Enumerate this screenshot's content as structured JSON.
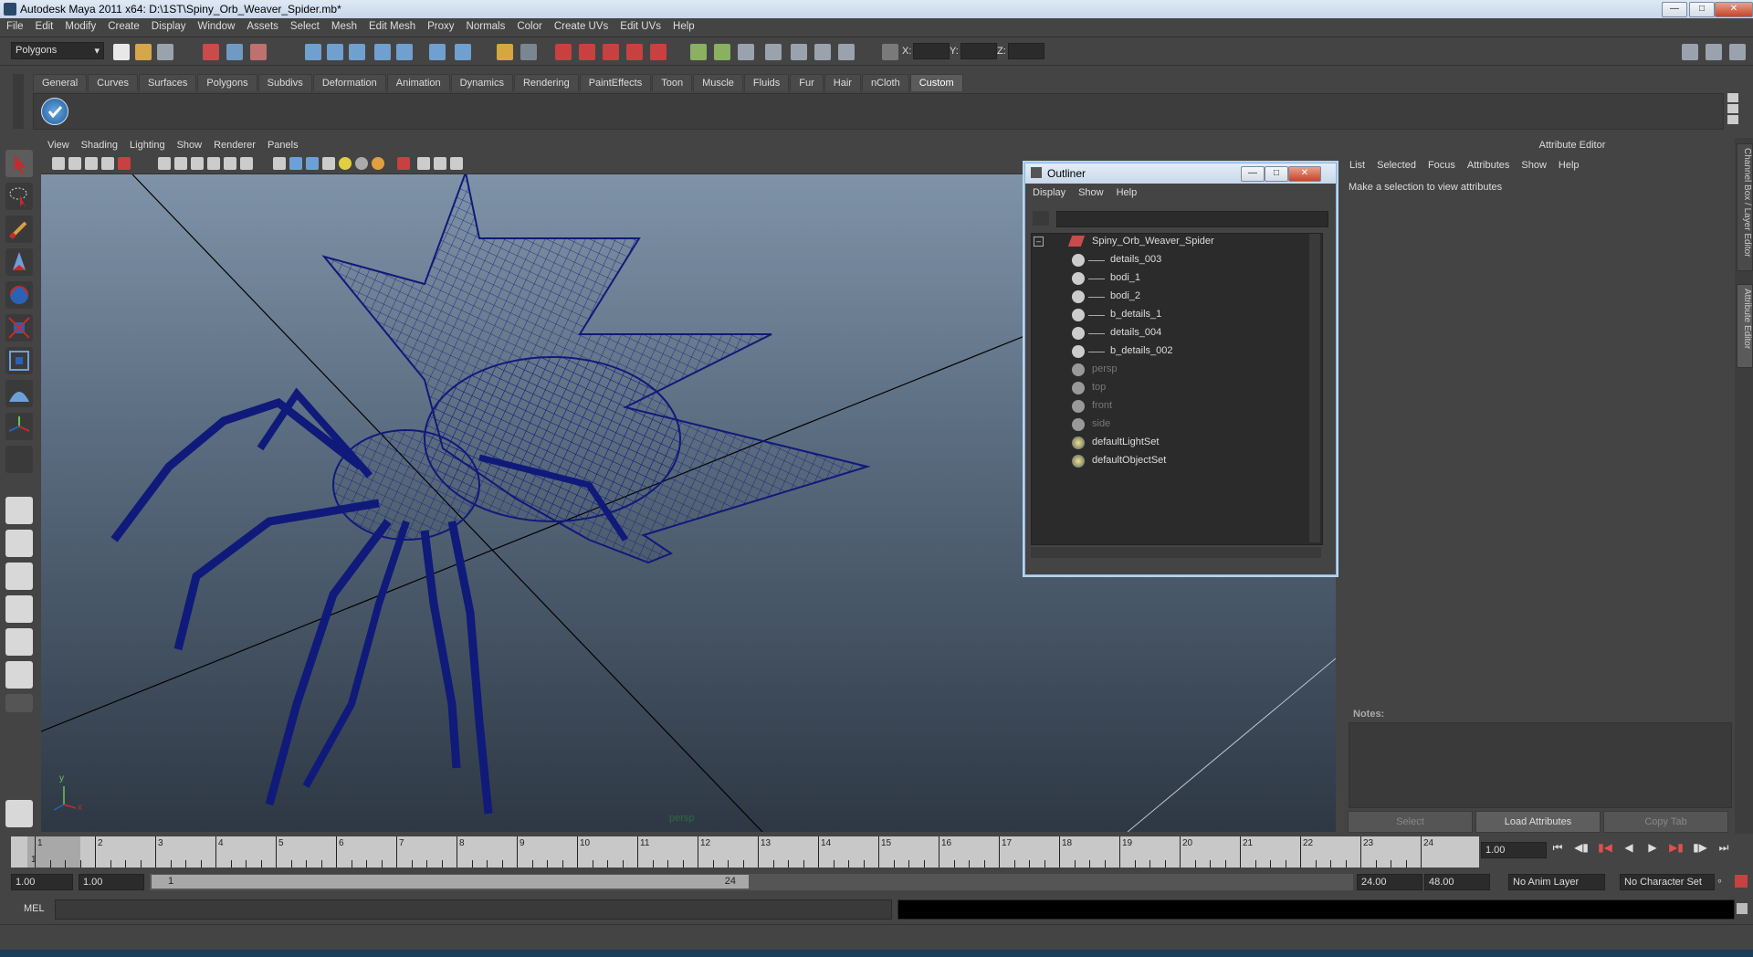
{
  "window": {
    "title": "Autodesk Maya 2011 x64: D:\\1ST\\Spiny_Orb_Weaver_Spider.mb*"
  },
  "menubar": [
    "File",
    "Edit",
    "Modify",
    "Create",
    "Display",
    "Window",
    "Assets",
    "Select",
    "Mesh",
    "Edit Mesh",
    "Proxy",
    "Normals",
    "Color",
    "Create UVs",
    "Edit UVs",
    "Help"
  ],
  "statusline": {
    "mode": "Polygons",
    "x_label": "X:",
    "y_label": "Y:",
    "z_label": "Z:"
  },
  "shelf": {
    "tabs": [
      "General",
      "Curves",
      "Surfaces",
      "Polygons",
      "Subdivs",
      "Deformation",
      "Animation",
      "Dynamics",
      "Rendering",
      "PaintEffects",
      "Toon",
      "Muscle",
      "Fluids",
      "Fur",
      "Hair",
      "nCloth",
      "Custom"
    ],
    "active": "Custom"
  },
  "viewport": {
    "menu": [
      "View",
      "Shading",
      "Lighting",
      "Show",
      "Renderer",
      "Panels"
    ],
    "camera_label": "persp",
    "axis_x": "x",
    "axis_y": "y"
  },
  "outliner": {
    "title": "Outliner",
    "menu": [
      "Display",
      "Show",
      "Help"
    ],
    "items": [
      {
        "label": "Spiny_Orb_Weaver_Spider",
        "level": 0,
        "dim": false,
        "type": "transform"
      },
      {
        "label": "details_003",
        "level": 1,
        "dim": false,
        "type": "mesh"
      },
      {
        "label": "bodi_1",
        "level": 1,
        "dim": false,
        "type": "mesh"
      },
      {
        "label": "bodi_2",
        "level": 1,
        "dim": false,
        "type": "mesh"
      },
      {
        "label": "b_details_1",
        "level": 1,
        "dim": false,
        "type": "mesh"
      },
      {
        "label": "details_004",
        "level": 1,
        "dim": false,
        "type": "mesh"
      },
      {
        "label": "b_details_002",
        "level": 1,
        "dim": false,
        "type": "mesh"
      },
      {
        "label": "persp",
        "level": 0,
        "dim": true,
        "type": "camera"
      },
      {
        "label": "top",
        "level": 0,
        "dim": true,
        "type": "camera"
      },
      {
        "label": "front",
        "level": 0,
        "dim": true,
        "type": "camera"
      },
      {
        "label": "side",
        "level": 0,
        "dim": true,
        "type": "camera"
      },
      {
        "label": "defaultLightSet",
        "level": 0,
        "dim": false,
        "type": "set"
      },
      {
        "label": "defaultObjectSet",
        "level": 0,
        "dim": false,
        "type": "set"
      }
    ]
  },
  "attribute_editor": {
    "title": "Attribute Editor",
    "menu": [
      "List",
      "Selected",
      "Focus",
      "Attributes",
      "Show",
      "Help"
    ],
    "message": "Make a selection to view attributes",
    "notes_label": "Notes:",
    "buttons": {
      "select": "Select",
      "load": "Load Attributes",
      "copy": "Copy Tab"
    }
  },
  "side_tabs": [
    "Channel Box / Layer Editor",
    "Attribute Editor"
  ],
  "timeslider": {
    "ticks": [
      "1",
      "2",
      "3",
      "4",
      "5",
      "6",
      "7",
      "8",
      "9",
      "10",
      "11",
      "12",
      "13",
      "14",
      "15",
      "16",
      "17",
      "18",
      "19",
      "20",
      "21",
      "22",
      "23",
      "24"
    ],
    "current_frame": "1",
    "current_time_field": "1.00"
  },
  "range": {
    "start": "1.00",
    "playback_start": "1.00",
    "range_start": "1",
    "range_end": "24",
    "playback_end": "24.00",
    "end": "48.00",
    "anim_layer": "No Anim Layer",
    "character_set": "No Character Set"
  },
  "cmdline": {
    "label": "MEL"
  },
  "colors": {
    "wireframe": "#0f1a7a",
    "panel": "#444444"
  }
}
